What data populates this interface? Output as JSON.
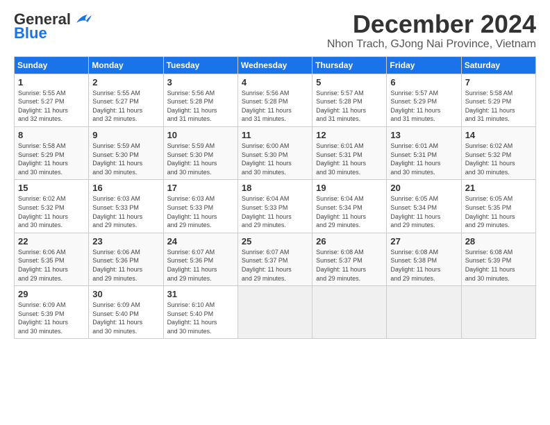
{
  "header": {
    "logo_general": "General",
    "logo_blue": "Blue",
    "title": "December 2024",
    "subtitle": "Nhon Trach, GJong Nai Province, Vietnam"
  },
  "calendar": {
    "days_of_week": [
      "Sunday",
      "Monday",
      "Tuesday",
      "Wednesday",
      "Thursday",
      "Friday",
      "Saturday"
    ],
    "weeks": [
      [
        {
          "day": "",
          "info": ""
        },
        {
          "day": "",
          "info": ""
        },
        {
          "day": "",
          "info": ""
        },
        {
          "day": "",
          "info": ""
        },
        {
          "day": "",
          "info": ""
        },
        {
          "day": "",
          "info": ""
        },
        {
          "day": "",
          "info": ""
        }
      ]
    ],
    "cells": [
      {
        "day": "1",
        "info": "Sunrise: 5:55 AM\nSunset: 5:27 PM\nDaylight: 11 hours\nand 32 minutes."
      },
      {
        "day": "2",
        "info": "Sunrise: 5:55 AM\nSunset: 5:27 PM\nDaylight: 11 hours\nand 32 minutes."
      },
      {
        "day": "3",
        "info": "Sunrise: 5:56 AM\nSunset: 5:28 PM\nDaylight: 11 hours\nand 31 minutes."
      },
      {
        "day": "4",
        "info": "Sunrise: 5:56 AM\nSunset: 5:28 PM\nDaylight: 11 hours\nand 31 minutes."
      },
      {
        "day": "5",
        "info": "Sunrise: 5:57 AM\nSunset: 5:28 PM\nDaylight: 11 hours\nand 31 minutes."
      },
      {
        "day": "6",
        "info": "Sunrise: 5:57 AM\nSunset: 5:29 PM\nDaylight: 11 hours\nand 31 minutes."
      },
      {
        "day": "7",
        "info": "Sunrise: 5:58 AM\nSunset: 5:29 PM\nDaylight: 11 hours\nand 31 minutes."
      },
      {
        "day": "8",
        "info": "Sunrise: 5:58 AM\nSunset: 5:29 PM\nDaylight: 11 hours\nand 30 minutes."
      },
      {
        "day": "9",
        "info": "Sunrise: 5:59 AM\nSunset: 5:30 PM\nDaylight: 11 hours\nand 30 minutes."
      },
      {
        "day": "10",
        "info": "Sunrise: 5:59 AM\nSunset: 5:30 PM\nDaylight: 11 hours\nand 30 minutes."
      },
      {
        "day": "11",
        "info": "Sunrise: 6:00 AM\nSunset: 5:30 PM\nDaylight: 11 hours\nand 30 minutes."
      },
      {
        "day": "12",
        "info": "Sunrise: 6:01 AM\nSunset: 5:31 PM\nDaylight: 11 hours\nand 30 minutes."
      },
      {
        "day": "13",
        "info": "Sunrise: 6:01 AM\nSunset: 5:31 PM\nDaylight: 11 hours\nand 30 minutes."
      },
      {
        "day": "14",
        "info": "Sunrise: 6:02 AM\nSunset: 5:32 PM\nDaylight: 11 hours\nand 30 minutes."
      },
      {
        "day": "15",
        "info": "Sunrise: 6:02 AM\nSunset: 5:32 PM\nDaylight: 11 hours\nand 30 minutes."
      },
      {
        "day": "16",
        "info": "Sunrise: 6:03 AM\nSunset: 5:33 PM\nDaylight: 11 hours\nand 29 minutes."
      },
      {
        "day": "17",
        "info": "Sunrise: 6:03 AM\nSunset: 5:33 PM\nDaylight: 11 hours\nand 29 minutes."
      },
      {
        "day": "18",
        "info": "Sunrise: 6:04 AM\nSunset: 5:33 PM\nDaylight: 11 hours\nand 29 minutes."
      },
      {
        "day": "19",
        "info": "Sunrise: 6:04 AM\nSunset: 5:34 PM\nDaylight: 11 hours\nand 29 minutes."
      },
      {
        "day": "20",
        "info": "Sunrise: 6:05 AM\nSunset: 5:34 PM\nDaylight: 11 hours\nand 29 minutes."
      },
      {
        "day": "21",
        "info": "Sunrise: 6:05 AM\nSunset: 5:35 PM\nDaylight: 11 hours\nand 29 minutes."
      },
      {
        "day": "22",
        "info": "Sunrise: 6:06 AM\nSunset: 5:35 PM\nDaylight: 11 hours\nand 29 minutes."
      },
      {
        "day": "23",
        "info": "Sunrise: 6:06 AM\nSunset: 5:36 PM\nDaylight: 11 hours\nand 29 minutes."
      },
      {
        "day": "24",
        "info": "Sunrise: 6:07 AM\nSunset: 5:36 PM\nDaylight: 11 hours\nand 29 minutes."
      },
      {
        "day": "25",
        "info": "Sunrise: 6:07 AM\nSunset: 5:37 PM\nDaylight: 11 hours\nand 29 minutes."
      },
      {
        "day": "26",
        "info": "Sunrise: 6:08 AM\nSunset: 5:37 PM\nDaylight: 11 hours\nand 29 minutes."
      },
      {
        "day": "27",
        "info": "Sunrise: 6:08 AM\nSunset: 5:38 PM\nDaylight: 11 hours\nand 29 minutes."
      },
      {
        "day": "28",
        "info": "Sunrise: 6:08 AM\nSunset: 5:39 PM\nDaylight: 11 hours\nand 30 minutes."
      },
      {
        "day": "29",
        "info": "Sunrise: 6:09 AM\nSunset: 5:39 PM\nDaylight: 11 hours\nand 30 minutes."
      },
      {
        "day": "30",
        "info": "Sunrise: 6:09 AM\nSunset: 5:40 PM\nDaylight: 11 hours\nand 30 minutes."
      },
      {
        "day": "31",
        "info": "Sunrise: 6:10 AM\nSunset: 5:40 PM\nDaylight: 11 hours\nand 30 minutes."
      }
    ],
    "start_day_of_week": 0
  }
}
